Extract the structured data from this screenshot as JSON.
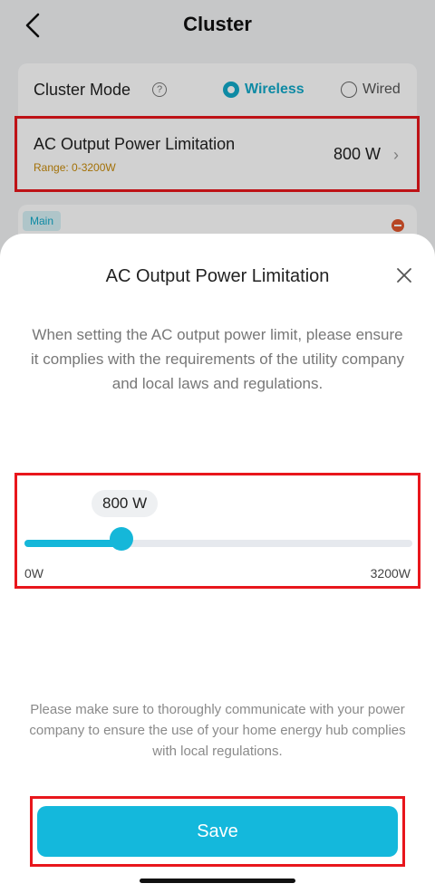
{
  "header": {
    "title": "Cluster"
  },
  "cluster_mode": {
    "label": "Cluster Mode",
    "options": [
      {
        "label": "Wireless",
        "selected": true
      },
      {
        "label": "Wired",
        "selected": false
      }
    ]
  },
  "ac_card": {
    "title": "AC Output Power Limitation",
    "range": "Range: 0-3200W",
    "value": "800 W"
  },
  "main_card": {
    "badge": "Main"
  },
  "sheet": {
    "title": "AC Output Power Limitation",
    "description": "When setting the AC output power limit, please ensure it complies with the requirements of the utility company and local laws and regulations.",
    "slider": {
      "value_label": "800 W",
      "value": 800,
      "min": 0,
      "max": 3200,
      "min_label": "0W",
      "max_label": "3200W"
    },
    "note": "Please make sure to thoroughly communicate with your power company to ensure the use of your home energy hub complies with local regulations.",
    "save_label": "Save"
  },
  "colors": {
    "accent": "#14b8dc",
    "highlight": "#e8161c",
    "range_text": "#c78a0a"
  }
}
